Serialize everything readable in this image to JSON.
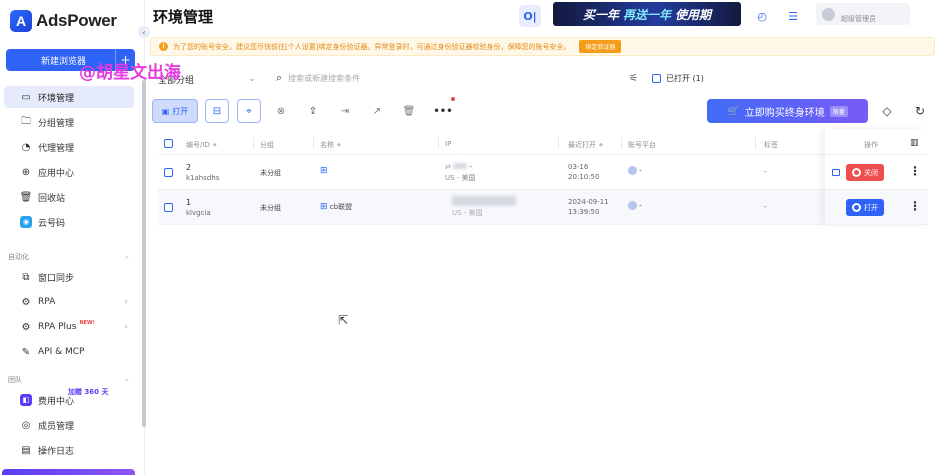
{
  "brand": {
    "name": "AdsPower",
    "logo_letter": "A"
  },
  "sidebar": {
    "new_browser_label": "新建浏览器",
    "main_items": [
      {
        "label": "环境管理",
        "icon": "monitor-icon",
        "active": true
      },
      {
        "label": "分组管理",
        "icon": "folder-icon"
      },
      {
        "label": "代理管理",
        "icon": "proxy-icon"
      },
      {
        "label": "应用中心",
        "icon": "grid-icon"
      },
      {
        "label": "回收站",
        "icon": "trash-icon"
      },
      {
        "label": "云号码",
        "icon": "cloud-phone-icon"
      }
    ],
    "automation_title": "自动化",
    "automation_items": [
      {
        "label": "窗口同步",
        "icon": "sync-icon"
      },
      {
        "label": "RPA",
        "icon": "rpa-icon",
        "chevron": true
      },
      {
        "label": "RPA Plus",
        "icon": "rpa-plus-icon",
        "chevron": true,
        "badge": "NEW!"
      },
      {
        "label": "API & MCP",
        "icon": "api-icon"
      }
    ],
    "team_title": "团队",
    "team_items": [
      {
        "label": "费用中心",
        "icon": "billing-icon"
      },
      {
        "label": "成员管理",
        "icon": "members-icon"
      },
      {
        "label": "操作日志",
        "icon": "log-icon"
      }
    ],
    "bonus_text": "加赠 360 天"
  },
  "header": {
    "title": "环境管理",
    "promo": {
      "part1": "买一年",
      "part2": "再送一年",
      "part3": "使用期"
    },
    "user_role": "超级管理员"
  },
  "notice": {
    "text": "为了您的账号安全，建议您尽快前往[个人设置]绑定身份验证器。异常登录时，可通过身份验证器校验身份，保障您的账号安全。",
    "button": "绑定验证器"
  },
  "watermark": "@胡星文出海",
  "filters": {
    "group_label": "全部分组",
    "search_placeholder": "搜索或新建搜索条件",
    "opened_label": "已打开 (1)"
  },
  "toolbar": {
    "open_label": "打开",
    "buy_label": "立即购买终身环境",
    "buy_tag": "限量"
  },
  "table": {
    "headers": {
      "id": "编号/ID",
      "group": "分组",
      "name": "名称",
      "ip": "IP",
      "last_open": "最近打开",
      "platform": "账号平台",
      "tags": "标签",
      "ops": "操作"
    },
    "rows": [
      {
        "num": "2",
        "id": "k1ahsdhs",
        "group": "未分组",
        "name": "",
        "ip_loc": "US - 美国",
        "date": "03-16",
        "time": "20:10:50",
        "platform": "-",
        "tags": "-",
        "action": "关闭",
        "status": "open"
      },
      {
        "num": "1",
        "id": "klvgcia",
        "group": "未分组",
        "name": "cb联盟",
        "ip_loc": "US - 美国",
        "date": "2024-09-11",
        "time": "13:39:50",
        "platform": "-",
        "tags": "-",
        "action": "打开",
        "status": "closed"
      }
    ]
  },
  "colors": {
    "accent": "#2f63f6",
    "danger": "#ef4e4e",
    "warning": "#f59c1a",
    "watermark": "#e53be0"
  }
}
